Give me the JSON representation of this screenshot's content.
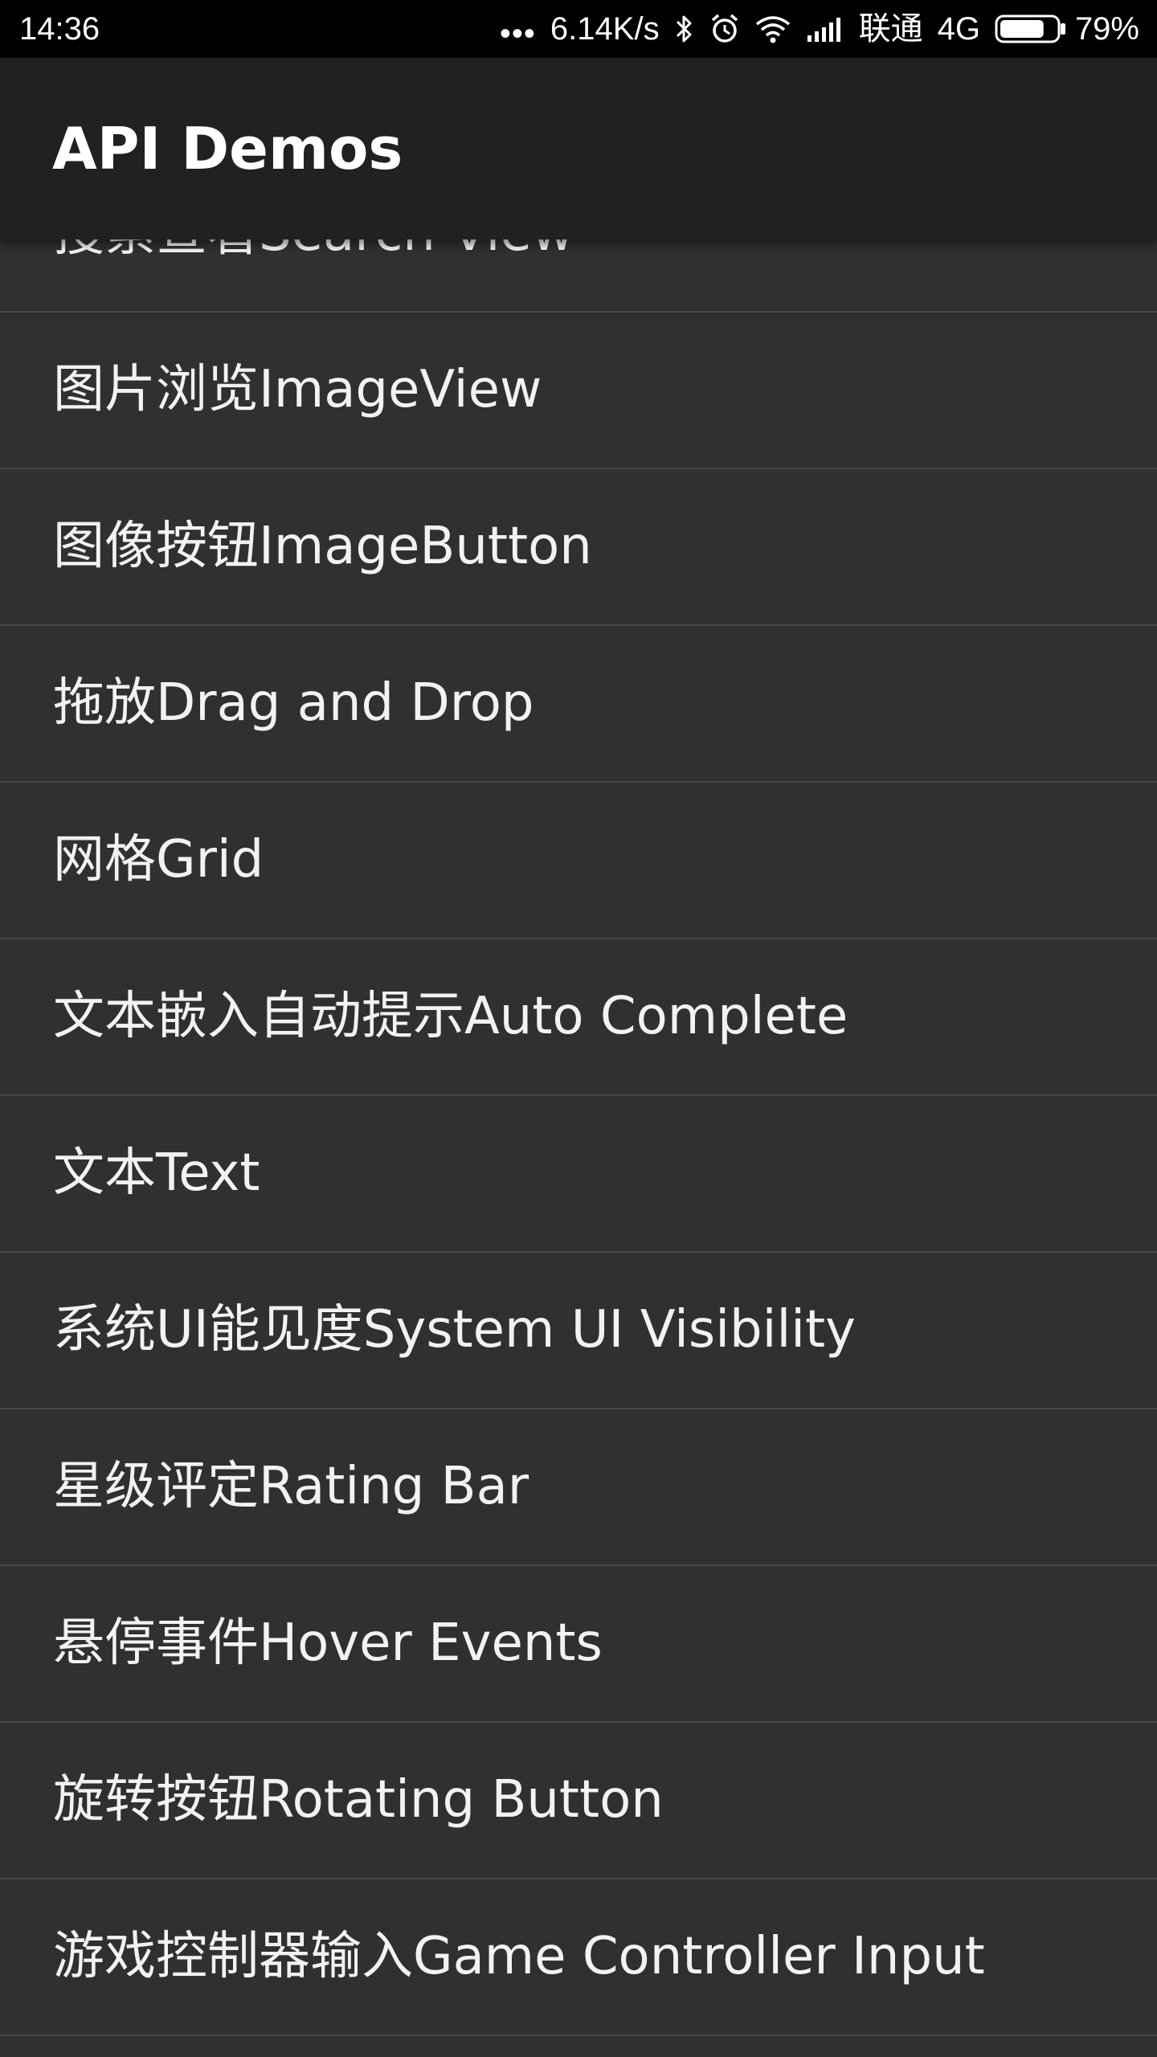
{
  "status_bar": {
    "time": "14:36",
    "network_speed": "6.14K/s",
    "carrier": "联通",
    "network_type": "4G",
    "battery_percent": "79%",
    "battery_level": 0.79,
    "icons": [
      "more-dots-icon",
      "bluetooth-icon",
      "alarm-icon",
      "wifi-icon",
      "signal-icon",
      "battery-icon"
    ]
  },
  "app_bar": {
    "title": "API Demos"
  },
  "list": {
    "items": [
      {
        "label": "搜索查看Search View"
      },
      {
        "label": "图片浏览ImageView"
      },
      {
        "label": "图像按钮ImageButton"
      },
      {
        "label": "拖放Drag and Drop"
      },
      {
        "label": "网格Grid"
      },
      {
        "label": "文本嵌入自动提示Auto Complete"
      },
      {
        "label": "文本Text"
      },
      {
        "label": "系统UI能见度System UI Visibility"
      },
      {
        "label": "星级评定Rating Bar"
      },
      {
        "label": "悬停事件Hover Events"
      },
      {
        "label": "旋转按钮Rotating Button"
      },
      {
        "label": "游戏控制器输入Game Controller Input"
      }
    ]
  },
  "colors": {
    "status_bar_bg": "#000000",
    "app_bar_bg": "#212121",
    "list_bg": "#303030",
    "divider": "#474747",
    "text": "#f2f2f2"
  }
}
